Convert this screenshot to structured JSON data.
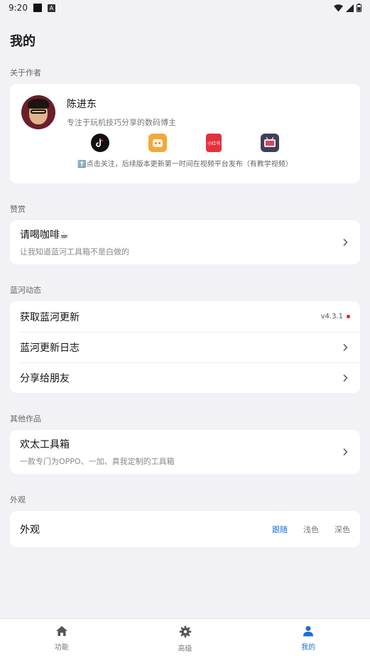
{
  "status": {
    "time": "9:20",
    "a_glyph": "A"
  },
  "page_title": "我的",
  "sections": {
    "about_author": "关于作者",
    "reward": "赞赏",
    "updates": "蓝河动态",
    "other_works": "其他作品",
    "appearance": "外观"
  },
  "author": {
    "name": "陈进东",
    "desc": "专注于玩机技巧分享的数码博主",
    "note": "⬆️点击关注，后续版本更新第一时间在视频平台发布（有教学视频）",
    "xhs_label": "小红书"
  },
  "reward": {
    "title": "请喝咖啡☕",
    "subtitle": "让我知道蓝河工具箱不是白做的"
  },
  "updates": {
    "get_update": "获取蓝河更新",
    "version": "v4.3.1",
    "changelog": "蓝河更新日志",
    "share": "分享给朋友"
  },
  "other_works": {
    "title": "欢太工具箱",
    "subtitle": "一款专门为OPPO、一加、真我定制的工具箱"
  },
  "appearance": {
    "label": "外观",
    "options": [
      "跟随",
      "浅色",
      "深色"
    ],
    "selected": "跟随"
  },
  "tabs": [
    "功能",
    "高级",
    "我的"
  ],
  "colors": {
    "accent": "#1a6fd6",
    "background": "#f2f2f6",
    "notify_dot": "#e02020"
  }
}
